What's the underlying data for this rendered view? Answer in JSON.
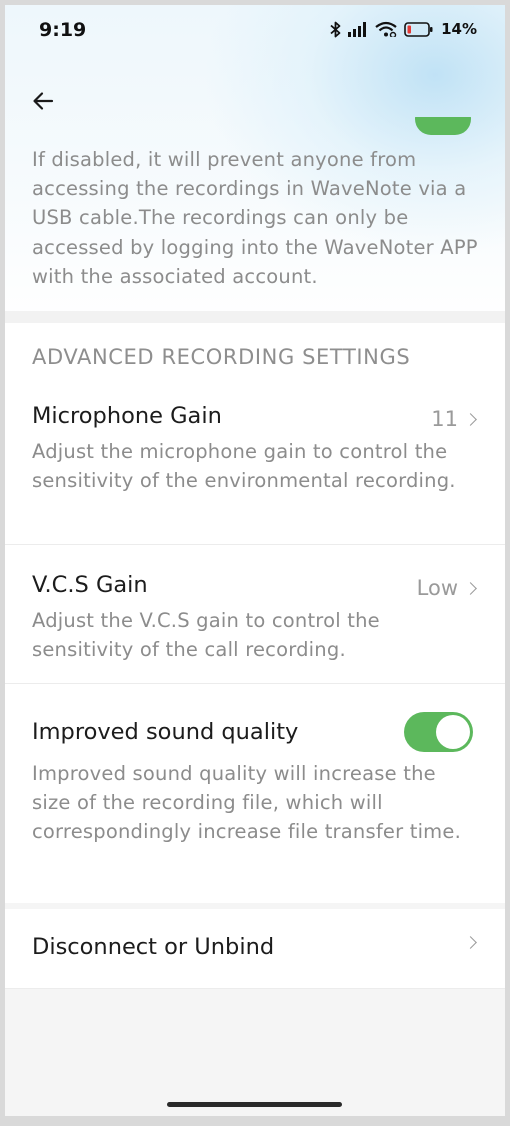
{
  "status_bar": {
    "time": "9:19",
    "battery": "14%",
    "icons": [
      "bluetooth-icon",
      "signal-icon",
      "wifi-icon",
      "battery-icon"
    ]
  },
  "nav": {
    "back_icon": "back-arrow-icon"
  },
  "usb_access": {
    "toggle_on": true,
    "description": "If disabled, it will prevent anyone from accessing the recordings in WaveNote via a USB cable.The recordings can only be accessed by logging into the WaveNoter APP with the associated account."
  },
  "advanced": {
    "header": "ADVANCED RECORDING SETTINGS",
    "microphone_gain": {
      "title": "Microphone Gain",
      "value": "11",
      "description": "Adjust the microphone gain to control the sensitivity of the environmental recording."
    },
    "vcs_gain": {
      "title": "V.C.S Gain",
      "value": "Low",
      "description": "Adjust the V.C.S gain to control the sensitivity of the call recording."
    },
    "improved_sound": {
      "title": "Improved sound quality",
      "toggle_on": true,
      "description": "Improved sound quality will increase the size of the recording file, which will correspondingly increase file transfer time."
    }
  },
  "disconnect": {
    "title": "Disconnect or Unbind"
  },
  "colors": {
    "accent_green": "#5cb85c",
    "secondary_text": "#8c8c8c",
    "background": "#f5f5f5"
  }
}
